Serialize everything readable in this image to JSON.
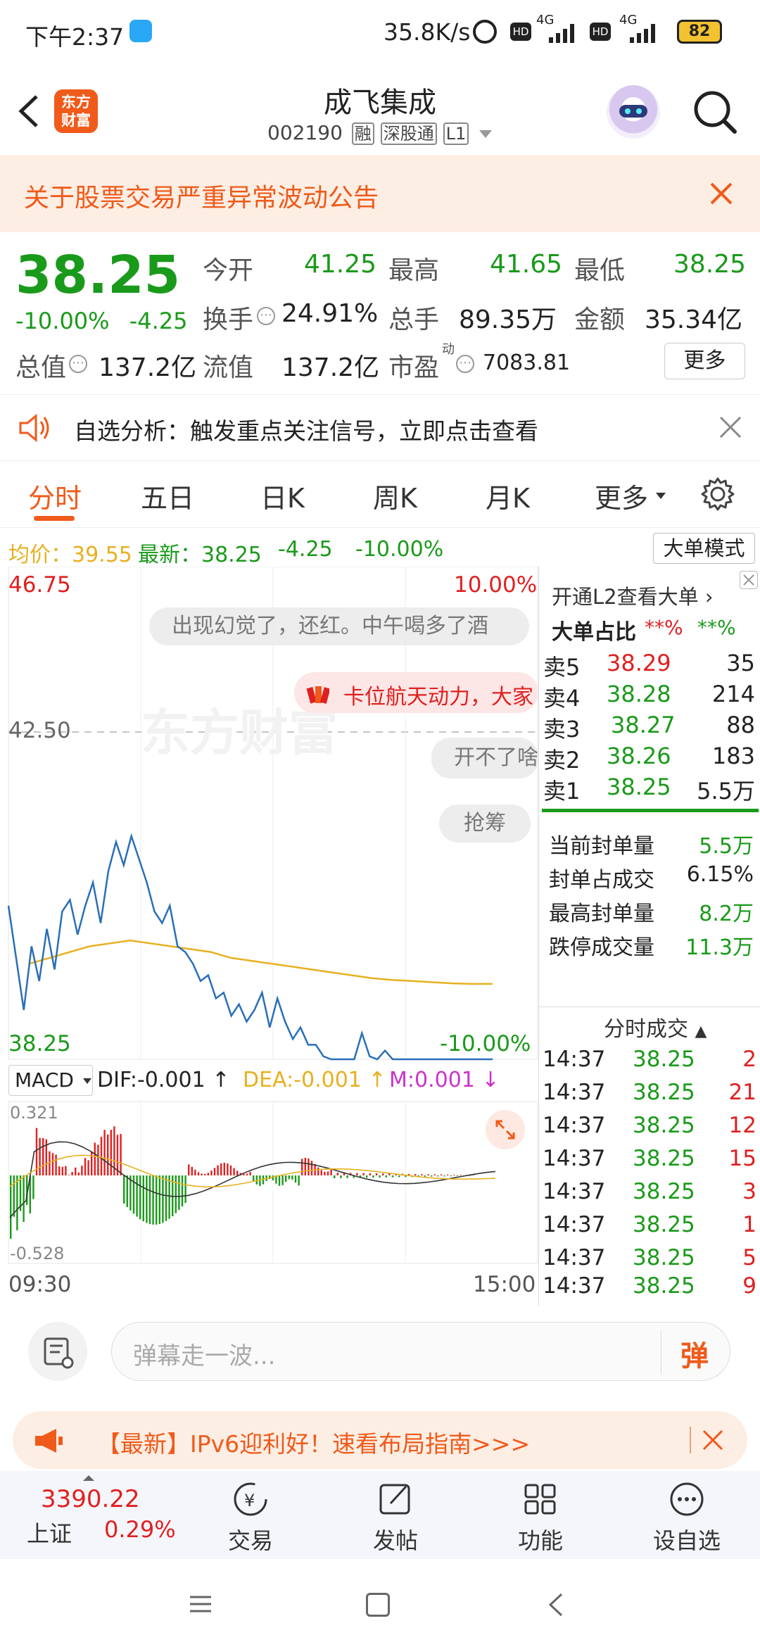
{
  "status_bar": {
    "time": "下午2:37",
    "net_speed": "35.8K/s",
    "battery": "82",
    "signal1": "4G",
    "signal2": "4G"
  },
  "header": {
    "logo_text_1": "东方",
    "logo_text_2": "财富",
    "stock_name": "成飞集成",
    "stock_code": "002190",
    "tags": [
      "融",
      "深股通",
      "L1"
    ]
  },
  "notice": {
    "text": "关于股票交易严重异常波动公告"
  },
  "quote": {
    "price": "38.25",
    "change_pct": "-10.00%",
    "change": "-4.25",
    "fields": [
      {
        "label": "今开",
        "value": "41.25"
      },
      {
        "label": "最高",
        "value": "41.65"
      },
      {
        "label": "最低",
        "value": "38.25"
      },
      {
        "label": "换手",
        "value": "24.91%"
      },
      {
        "label": "总手",
        "value": "89.35万"
      },
      {
        "label": "金额",
        "value": "35.34亿"
      },
      {
        "label": "总值",
        "value": "137.2亿"
      },
      {
        "label": "流值",
        "value": "137.2亿"
      },
      {
        "label": "市盈",
        "value": "7083.81"
      }
    ],
    "pe_sup": "动",
    "more_button": "更多"
  },
  "analysis": {
    "text": "自选分析：触发重点关注信号，立即点击查看"
  },
  "tabs": [
    "分时",
    "五日",
    "日K",
    "周K",
    "月K",
    "更多"
  ],
  "avg_row": {
    "avg_label": "均价：",
    "avg_value": "39.55",
    "latest_label": "最新：",
    "latest_value": "38.25",
    "change": "-4.25",
    "change_pct": "-10.00%",
    "mode_button": "大单模式"
  },
  "chart": {
    "y_top": "46.75",
    "y_mid": "42.50",
    "y_bottom": "38.25",
    "pct_top": "10.00%",
    "pct_bottom": "-10.00%",
    "watermark": "东方财富",
    "x_start": "09:30",
    "x_end": "15:00",
    "indicator": "MACD",
    "dif": "DIF:-0.001",
    "dea": "DEA:-0.001",
    "m": "M:0.001",
    "macd_top": "0.321",
    "macd_bottom": "-0.528",
    "bubbles": [
      "出现幻觉了，还红。中午喝多了酒",
      "卡位航天动力，大家",
      "开不了啥",
      "抢筹"
    ]
  },
  "side": {
    "l2_link": "开通L2查看大单",
    "big_order_label": "大单占比",
    "big_order_v1": "**%",
    "big_order_v2": "**%",
    "asks": [
      {
        "label": "卖5",
        "price": "38.29",
        "vol": "35"
      },
      {
        "label": "卖4",
        "price": "38.28",
        "vol": "214"
      },
      {
        "label": "卖3",
        "price": "38.27",
        "vol": "88"
      },
      {
        "label": "卖2",
        "price": "38.26",
        "vol": "183"
      },
      {
        "label": "卖1",
        "price": "38.25",
        "vol": "5.5万"
      }
    ],
    "stats": [
      {
        "label": "当前封单量",
        "value": "5.5万"
      },
      {
        "label": "封单占成交",
        "value": "6.15%"
      },
      {
        "label": "最高封单量",
        "value": "8.2万"
      },
      {
        "label": "跌停成交量",
        "value": "11.3万"
      }
    ],
    "trades_title": "分时成交",
    "trades": [
      {
        "time": "14:37",
        "price": "38.25",
        "vol": "2"
      },
      {
        "time": "14:37",
        "price": "38.25",
        "vol": "21"
      },
      {
        "time": "14:37",
        "price": "38.25",
        "vol": "12"
      },
      {
        "time": "14:37",
        "price": "38.25",
        "vol": "15"
      },
      {
        "time": "14:37",
        "price": "38.25",
        "vol": "3"
      },
      {
        "time": "14:37",
        "price": "38.25",
        "vol": "1"
      },
      {
        "time": "14:37",
        "price": "38.25",
        "vol": "5"
      },
      {
        "time": "14:37",
        "price": "38.25",
        "vol": "9"
      }
    ]
  },
  "comment": {
    "placeholder": "弹幕走一波...",
    "danmu_button": "弹"
  },
  "promo": {
    "text": "【最新】IPv6迎利好！速看布局指南>>>"
  },
  "bottom_nav": {
    "index_value": "3390.22",
    "index_name": "上证",
    "index_change": "0.29%",
    "items": [
      "交易",
      "发帖",
      "功能",
      "设自选"
    ]
  },
  "colors": {
    "up": "#e02020",
    "down": "#1a9a1a",
    "accent": "#f05a1a",
    "avg_line": "#e8b020",
    "price_line": "#2a6fb8"
  }
}
